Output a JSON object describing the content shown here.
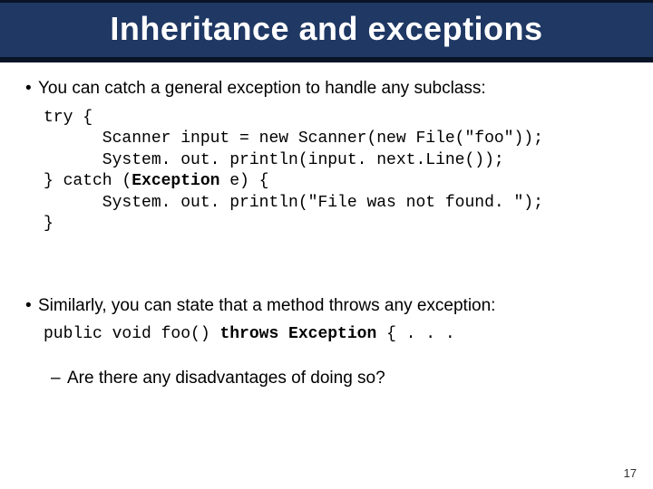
{
  "title": "Inheritance and exceptions",
  "bullet1": "You can catch a general exception to handle any subclass:",
  "code1_l1": "try {",
  "code1_l2": "      Scanner input = new Scanner(new File(\"foo\"));",
  "code1_l3": "      System. out. println(input. next.Line());",
  "code1_l4a": "} catch (",
  "code1_l4b": "Exception",
  "code1_l4c": " e) {",
  "code1_l5": "      System. out. println(\"File was not found. \");",
  "code1_l6": "}",
  "bullet2": "Similarly, you can state that a method throws any exception:",
  "code2_a": "public void foo() ",
  "code2_b": "throws Exception",
  "code2_c": " { . . .",
  "sub_bullet": "Are there any disadvantages of doing so?",
  "page_number": "17"
}
